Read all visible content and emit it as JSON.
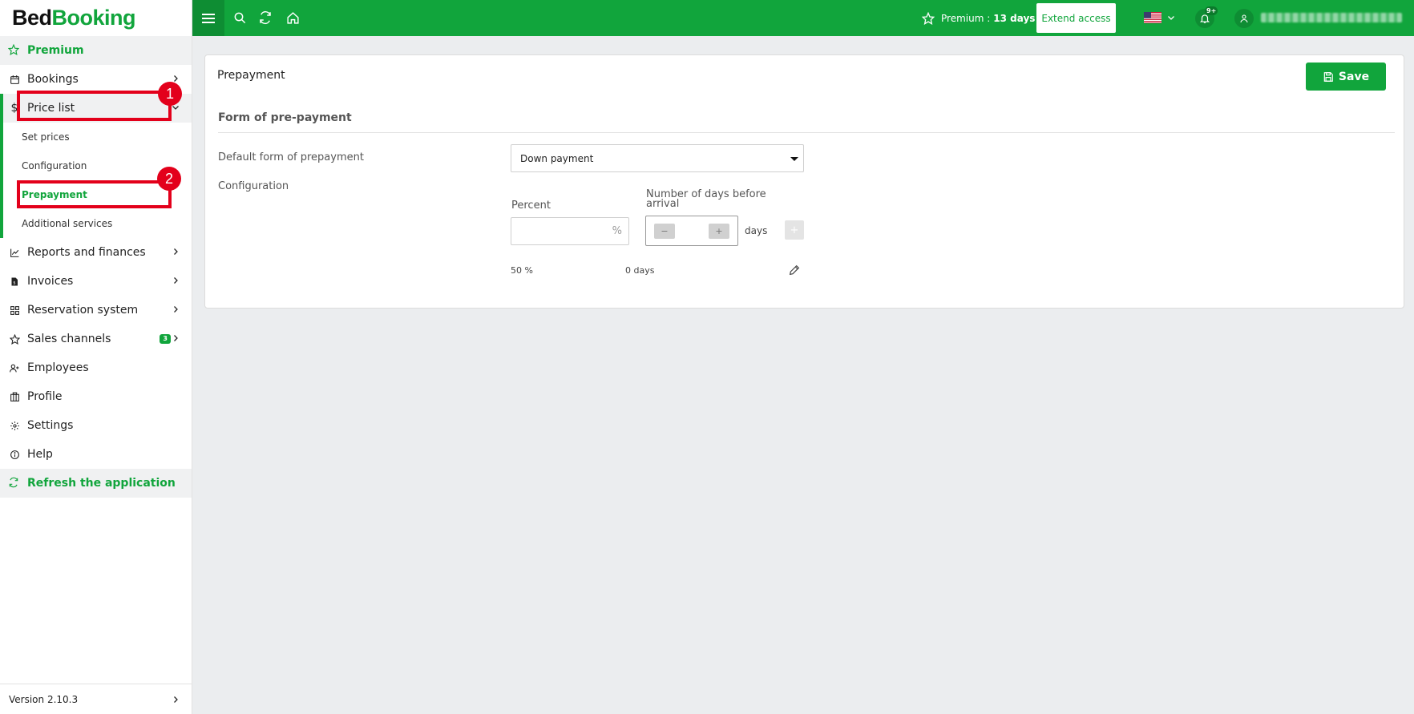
{
  "brand": {
    "part1": "Bed",
    "part2": "Booking"
  },
  "sidebar": {
    "premium": "Premium",
    "items": [
      {
        "label": "Bookings"
      },
      {
        "label": "Price list"
      },
      {
        "label": "Reports and finances"
      },
      {
        "label": "Invoices"
      },
      {
        "label": "Reservation system"
      },
      {
        "label": "Sales channels",
        "badge": "3"
      },
      {
        "label": "Employees"
      },
      {
        "label": "Profile"
      },
      {
        "label": "Settings"
      },
      {
        "label": "Help"
      }
    ],
    "price_list_sub": [
      "Set prices",
      "Configuration",
      "Prepayment",
      "Additional services"
    ],
    "refresh": "Refresh the application",
    "version": "Version 2.10.3"
  },
  "annotations": {
    "step1": "1",
    "step2": "2"
  },
  "topbar": {
    "premium_label": "Premium :",
    "premium_days": "13 days",
    "extend": "Extend access",
    "notifications": "9+"
  },
  "main": {
    "title": "Prepayment",
    "save": "Save",
    "section": "Form of pre-payment",
    "default_label": "Default form of prepayment",
    "default_value": "Down payment",
    "config_label": "Configuration",
    "percent_label": "Percent",
    "percent_unit": "%",
    "days_label": "Number of days before arrival",
    "days_unit": "days",
    "minus": "−",
    "plus": "+",
    "add": "+",
    "row": {
      "percent": "50 %",
      "days": "0 days"
    }
  },
  "colors": {
    "accent": "#11a53c",
    "highlight": "#e3001b"
  }
}
